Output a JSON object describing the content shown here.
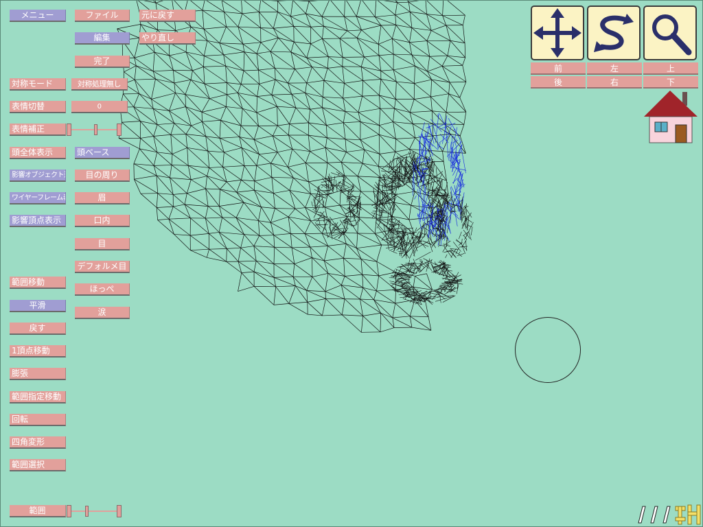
{
  "left_column": {
    "menu": "メニュー",
    "symmetry_mode": "対称モード",
    "expression_switch": "表情切替",
    "expression_correct": "表情補正",
    "head_all_view": "頭全体表示",
    "influence_object_select": "影響オブジェクト選択",
    "wireframe_view": "ワイヤーフレーム表示",
    "influence_vertex_view": "影響頂点表示",
    "range_move": "範囲移動",
    "smooth": "平滑",
    "undo_step": "戻す",
    "one_vertex_move": "1頂点移動",
    "inflate": "膨張",
    "range_specified_move": "範囲指定移動",
    "rotate": "回転",
    "quad_transform": "四角変形",
    "range_select": "範囲選択",
    "range": "範囲"
  },
  "middle_column": {
    "file": "ファイル",
    "edit": "編集",
    "done": "完了",
    "symmetry_off": "対称処理無し",
    "expression_value": "0",
    "head_base": "頭ベース",
    "around_eyes": "目の周り",
    "eyebrow": "眉",
    "mouth_inside": "口内",
    "eye": "目",
    "deformed_eye": "デフォルメ目",
    "cheek": "ほっぺ",
    "tears": "涙"
  },
  "top_row": {
    "undo": "元に戻す",
    "redo": "やり直し"
  },
  "nav": {
    "tools": [
      "move-arrows-icon",
      "rotate-icon",
      "zoom-magnifier-icon"
    ],
    "front": "前",
    "left": "左",
    "up": "上",
    "back": "後",
    "right": "右",
    "down": "下"
  },
  "sliders": {
    "expression_correct_level": 0.5,
    "range_level": 0.3
  },
  "colors": {
    "background": "#9cdcc4",
    "button": "#e2a09b",
    "button_selected": "#a09dd2",
    "wire": "#111111",
    "wire_accent": "#1020e0"
  }
}
